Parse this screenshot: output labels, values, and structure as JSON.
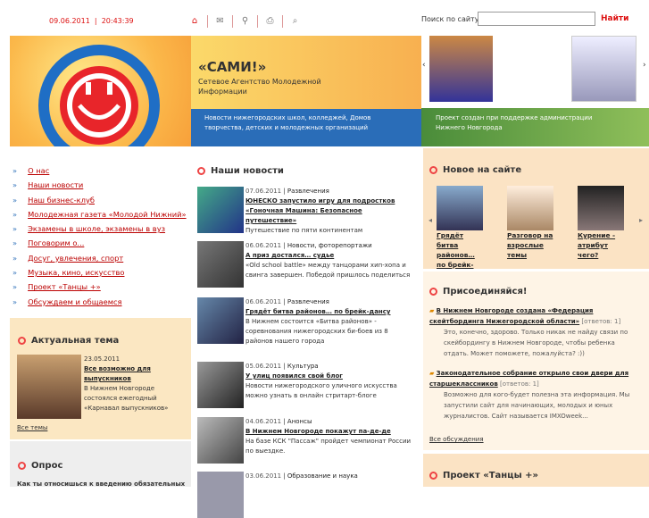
{
  "header": {
    "date": "09.06.2011",
    "time": "20:43:39",
    "search_label": "Поиск по сайту:",
    "search_value": "",
    "search_button": "Найти"
  },
  "banner": {
    "brand": "«САМИ!»",
    "tagline": "Сетевое Агентство Молодежной Информации",
    "blue_text": "Новости нижегородских школ, колледжей, Домов творчества, детских и молодежных организаций",
    "green_text": "Проект создан при поддержке администрации Нижнего Новгорода",
    "prev": "‹",
    "next": "›"
  },
  "nav": [
    "О нас",
    "Наши новости",
    "Наш бизнес-клуб",
    "Молодежная газета «Молодой Нижний»",
    "Экзамены в школе, экзамены в вуз",
    "Поговорим о...",
    "Досуг, увлечения, спорт",
    "Музыка, кино, искусство",
    "Проект «Танцы +»",
    "Обсуждаем и общаемся"
  ],
  "actual": {
    "heading": "Актуальная тема",
    "date": "23.05.2011",
    "title": "Все возможно для выпускников",
    "text": "В Нижнем Новгороде состоялся ежегодный «Карнавал выпускников»",
    "all": "Все темы"
  },
  "poll": {
    "heading": "Опрос",
    "text": "Как ты относишься к введению обязательных"
  },
  "news": {
    "heading": "Наши новости",
    "items": [
      {
        "date": "07.06.2011",
        "cat": "Развлечения",
        "title": "ЮНЕСКО запустило игру для подростков «Гоночная Машина: Безопасное путешествие»",
        "text": "Путешествие по пяти континентам"
      },
      {
        "date": "06.06.2011",
        "cat": "Новости, фоторепортажи",
        "title": "А приз достался… судье",
        "text": "«Old school battle» между танцорами хип-хопа и свинга завершен. Победой пришлось поделиться"
      },
      {
        "date": "06.06.2011",
        "cat": "Развлечения",
        "title": "Грядёт битва районов… по брейк-дансу",
        "text": "В Нижнем состоится «Битва районов» - соревнования нижегородских би-боев из 8 районов нашего города"
      },
      {
        "date": "05.06.2011",
        "cat": "Культура",
        "title": "У улиц появился свой блог",
        "text": "Новости нижегородского уличного искусства можно узнать в онлайн стритарт-блоге"
      },
      {
        "date": "04.06.2011",
        "cat": "Анонсы",
        "title": "В Нижнем Новгороде покажут па-де-де",
        "text": "На базе КСК \"Пассаж\" пройдет чемпионат России по выездке."
      },
      {
        "date": "03.06.2011",
        "cat": "Образование и наука",
        "title": "",
        "text": ""
      }
    ]
  },
  "newsite": {
    "heading": "Новое на сайте",
    "cards": [
      "Грядёт битва районов… по брейк-дансу",
      "Разговор на взрослые темы",
      "Курение - атрибут чего?"
    ]
  },
  "join": {
    "heading": "Присоединяйся!",
    "items": [
      {
        "title": "В Нижнем Новгороде создана «Федерация скейтбординга Нижегородской области»",
        "count": "[ответов: 1]",
        "text": "Это, конечно, здорово. Только никак не найду связи по скейбордингу в Нижнем Новгороде, чтобы ребенка отдать. Может поможете, пожалуйста? :))"
      },
      {
        "title": "Законодательное собрание открыло свои двери для старшеклассников",
        "count": "[ответов: 1]",
        "text": "Возможно для кого-будет полезна эта информация. Мы запустили сайт для начинающих, молодых и юных журналистов. Сайт называется IMXOweek..."
      }
    ],
    "all": "Все обсуждения"
  },
  "dance": {
    "heading": "Проект «Танцы +»"
  }
}
